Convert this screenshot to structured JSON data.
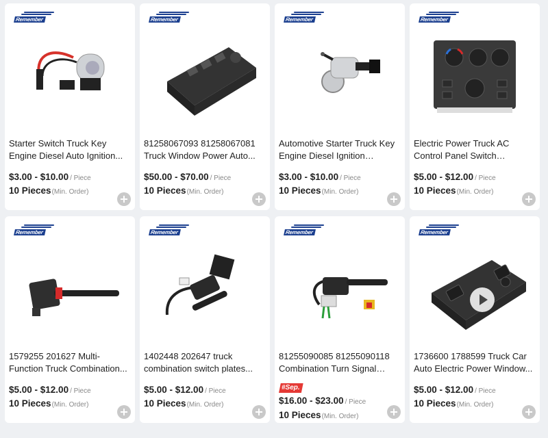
{
  "brand": {
    "logo_text": "Remember"
  },
  "products": [
    {
      "title": "Starter Switch Truck Key Engine Diesel Auto Ignition...",
      "price": "$3.00 - $10.00",
      "price_unit": "/ Piece",
      "moq": "10 Pieces",
      "moq_unit": "(Min. Order)",
      "image_icon": "ignition-switch-icon",
      "tag": null,
      "video": false
    },
    {
      "title": "81258067093 81258067081 Truck Window Power Auto...",
      "price": "$50.00 - $70.00",
      "price_unit": "/ Piece",
      "moq": "10 Pieces",
      "moq_unit": "(Min. Order)",
      "image_icon": "window-switch-icon",
      "tag": null,
      "video": false
    },
    {
      "title": "Automotive Starter Truck Key Engine Diesel Ignition Switch...",
      "price": "$3.00 - $10.00",
      "price_unit": "/ Piece",
      "moq": "10 Pieces",
      "moq_unit": "(Min. Order)",
      "image_icon": "ignition-lock-icon",
      "tag": null,
      "video": false
    },
    {
      "title": "Electric Power Truck AC Control Panel Switch 213181...",
      "price": "$5.00 - $12.00",
      "price_unit": "/ Piece",
      "moq": "10 Pieces",
      "moq_unit": "(Min. Order)",
      "image_icon": "ac-panel-icon",
      "tag": null,
      "video": false
    },
    {
      "title": "1579255 201627 Multi-Function Truck Combination...",
      "price": "$5.00 - $12.00",
      "price_unit": "/ Piece",
      "moq": "10 Pieces",
      "moq_unit": "(Min. Order)",
      "image_icon": "stalk-switch-icon",
      "tag": null,
      "video": false
    },
    {
      "title": "1402448 202647 truck combination switch plates...",
      "price": "$5.00 - $12.00",
      "price_unit": "/ Piece",
      "moq": "10 Pieces",
      "moq_unit": "(Min. Order)",
      "image_icon": "combination-switch-icon",
      "tag": null,
      "video": false
    },
    {
      "title": "81255090085 81255090118 Combination Turn Signal Truc...",
      "price": "$16.00 - $23.00",
      "price_unit": "/ Piece",
      "moq": "10 Pieces",
      "moq_unit": "(Min. Order)",
      "image_icon": "turn-signal-switch-icon",
      "tag": "#Sep.",
      "video": false
    },
    {
      "title": "1736600 1788599 Truck Car Auto Electric Power Window...",
      "price": "$5.00 - $12.00",
      "price_unit": "/ Piece",
      "moq": "10 Pieces",
      "moq_unit": "(Min. Order)",
      "image_icon": "power-window-switch-icon",
      "tag": null,
      "video": true
    }
  ]
}
